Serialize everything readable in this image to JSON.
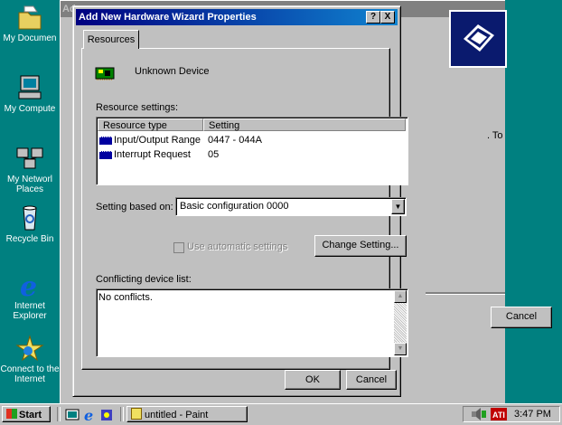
{
  "desktop": {
    "icons": [
      {
        "label": "My Documen"
      },
      {
        "label": "My Compute"
      },
      {
        "label": "My Networl Places"
      },
      {
        "label": "Recycle Bin"
      },
      {
        "label": "Internet Explorer"
      },
      {
        "label": "Connect to the Internet"
      }
    ]
  },
  "background_window": {
    "title_prefix": "Ad",
    "partial_text": ". To",
    "cancel_label": "Cancel"
  },
  "dialog": {
    "title": "Add New Hardware Wizard Properties",
    "help_btn": "?",
    "close_btn": "X",
    "tab_label": "Resources",
    "device_name": "Unknown Device",
    "resource_settings_label": "Resource settings:",
    "columns": [
      "Resource type",
      "Setting"
    ],
    "resources": [
      {
        "type": "Input/Output Range",
        "setting": "0447 - 044A"
      },
      {
        "type": "Interrupt Request",
        "setting": "05"
      }
    ],
    "setting_based_on_label": "Setting based on:",
    "setting_based_on_value": "Basic configuration 0000",
    "use_auto_label": "Use automatic settings",
    "change_setting_label": "Change Setting...",
    "conflicting_label": "Conflicting device list:",
    "conflicts_text": "No conflicts.",
    "ok_label": "OK",
    "cancel_label": "Cancel"
  },
  "taskbar": {
    "start_label": "Start",
    "task_label": "untitled - Paint",
    "clock": "3:47 PM"
  }
}
